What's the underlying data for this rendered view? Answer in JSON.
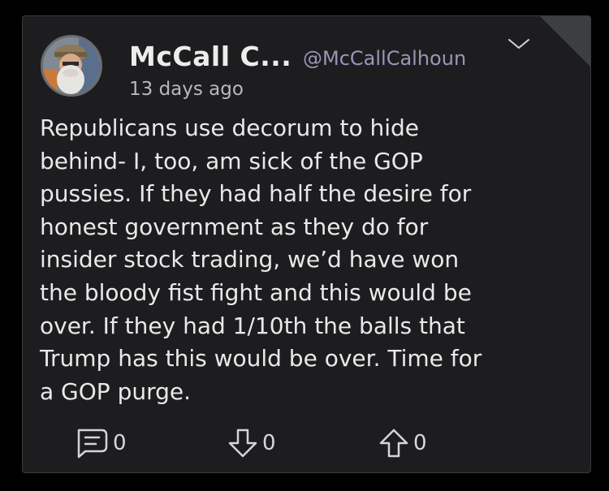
{
  "post": {
    "author_name": "McCall C...",
    "author_handle": "@McCallCalhoun",
    "timestamp": "13 days ago",
    "body": "Republicans use decorum to hide\nbehind- I, too, am sick of the GOP\npussies. If they had half the desire for\nhonest government as they do for\ninsider stock trading, we’d have won\nthe bloody fist fight and this would be\nover. If they had 1/10th the balls that\nTrump has this would be over. Time for\na GOP purge."
  },
  "actions": {
    "comment_count": "0",
    "downvote_count": "0",
    "upvote_count": "0"
  },
  "icons": {
    "avatar": "user-avatar",
    "menu": "chevron-down-icon",
    "comment": "comment-icon",
    "downvote": "arrow-down-icon",
    "upvote": "arrow-up-icon"
  },
  "colors": {
    "background": "#000000",
    "card": "#1d1d1f",
    "handle": "#9b95b8",
    "text": "#e9e9ea"
  }
}
